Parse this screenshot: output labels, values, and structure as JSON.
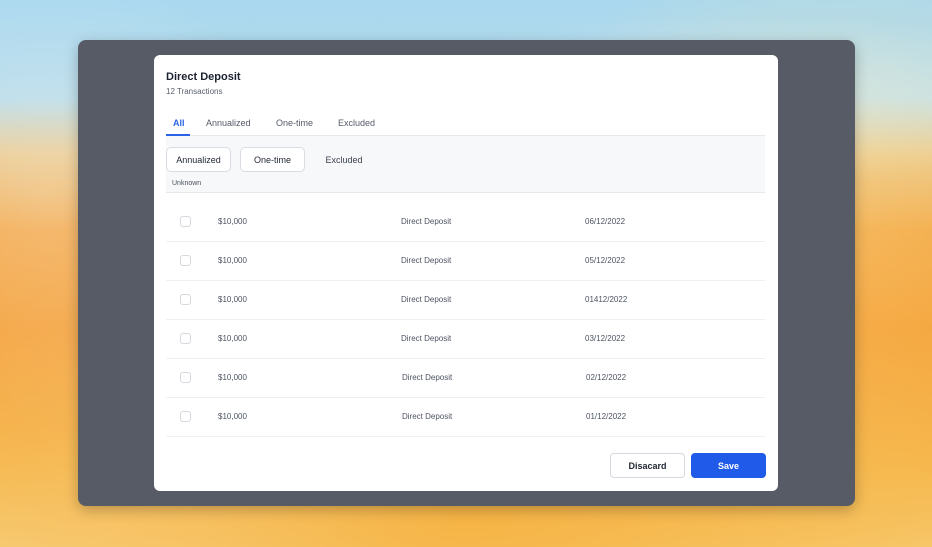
{
  "modal": {
    "title": "Direct Deposit",
    "subtitle": "12 Transactions"
  },
  "tabs": [
    {
      "label": "All",
      "active": true
    },
    {
      "label": "Annualized",
      "active": false
    },
    {
      "label": "One-time",
      "active": false
    },
    {
      "label": "Excluded",
      "active": false
    }
  ],
  "filters": {
    "chips": [
      {
        "label": "Annualized"
      },
      {
        "label": "One-time"
      },
      {
        "label": "Excluded"
      }
    ],
    "unknown_label": "Unknown"
  },
  "transactions": [
    {
      "amount": "$10,000",
      "description": "Direct Deposit",
      "date": "06/12/2022",
      "checked": false
    },
    {
      "amount": "$10,000",
      "description": "Direct Deposit",
      "date": "05/12/2022",
      "checked": false
    },
    {
      "amount": "$10,000",
      "description": "Direct Deposit",
      "date": "01412/2022",
      "checked": false
    },
    {
      "amount": "$10,000",
      "description": "Direct Deposit",
      "date": "03/12/2022",
      "checked": false
    },
    {
      "amount": "$10,000",
      "description": "Direct Deposit",
      "date": "02/12/2022",
      "checked": false
    },
    {
      "amount": "$10,000",
      "description": "Direct Deposit",
      "date": "01/12/2022",
      "checked": false
    }
  ],
  "actions": {
    "discard_label": "Disacard",
    "save_label": "Save"
  },
  "colors": {
    "accent": "#1f5ae8",
    "device_frame": "#565b66"
  }
}
